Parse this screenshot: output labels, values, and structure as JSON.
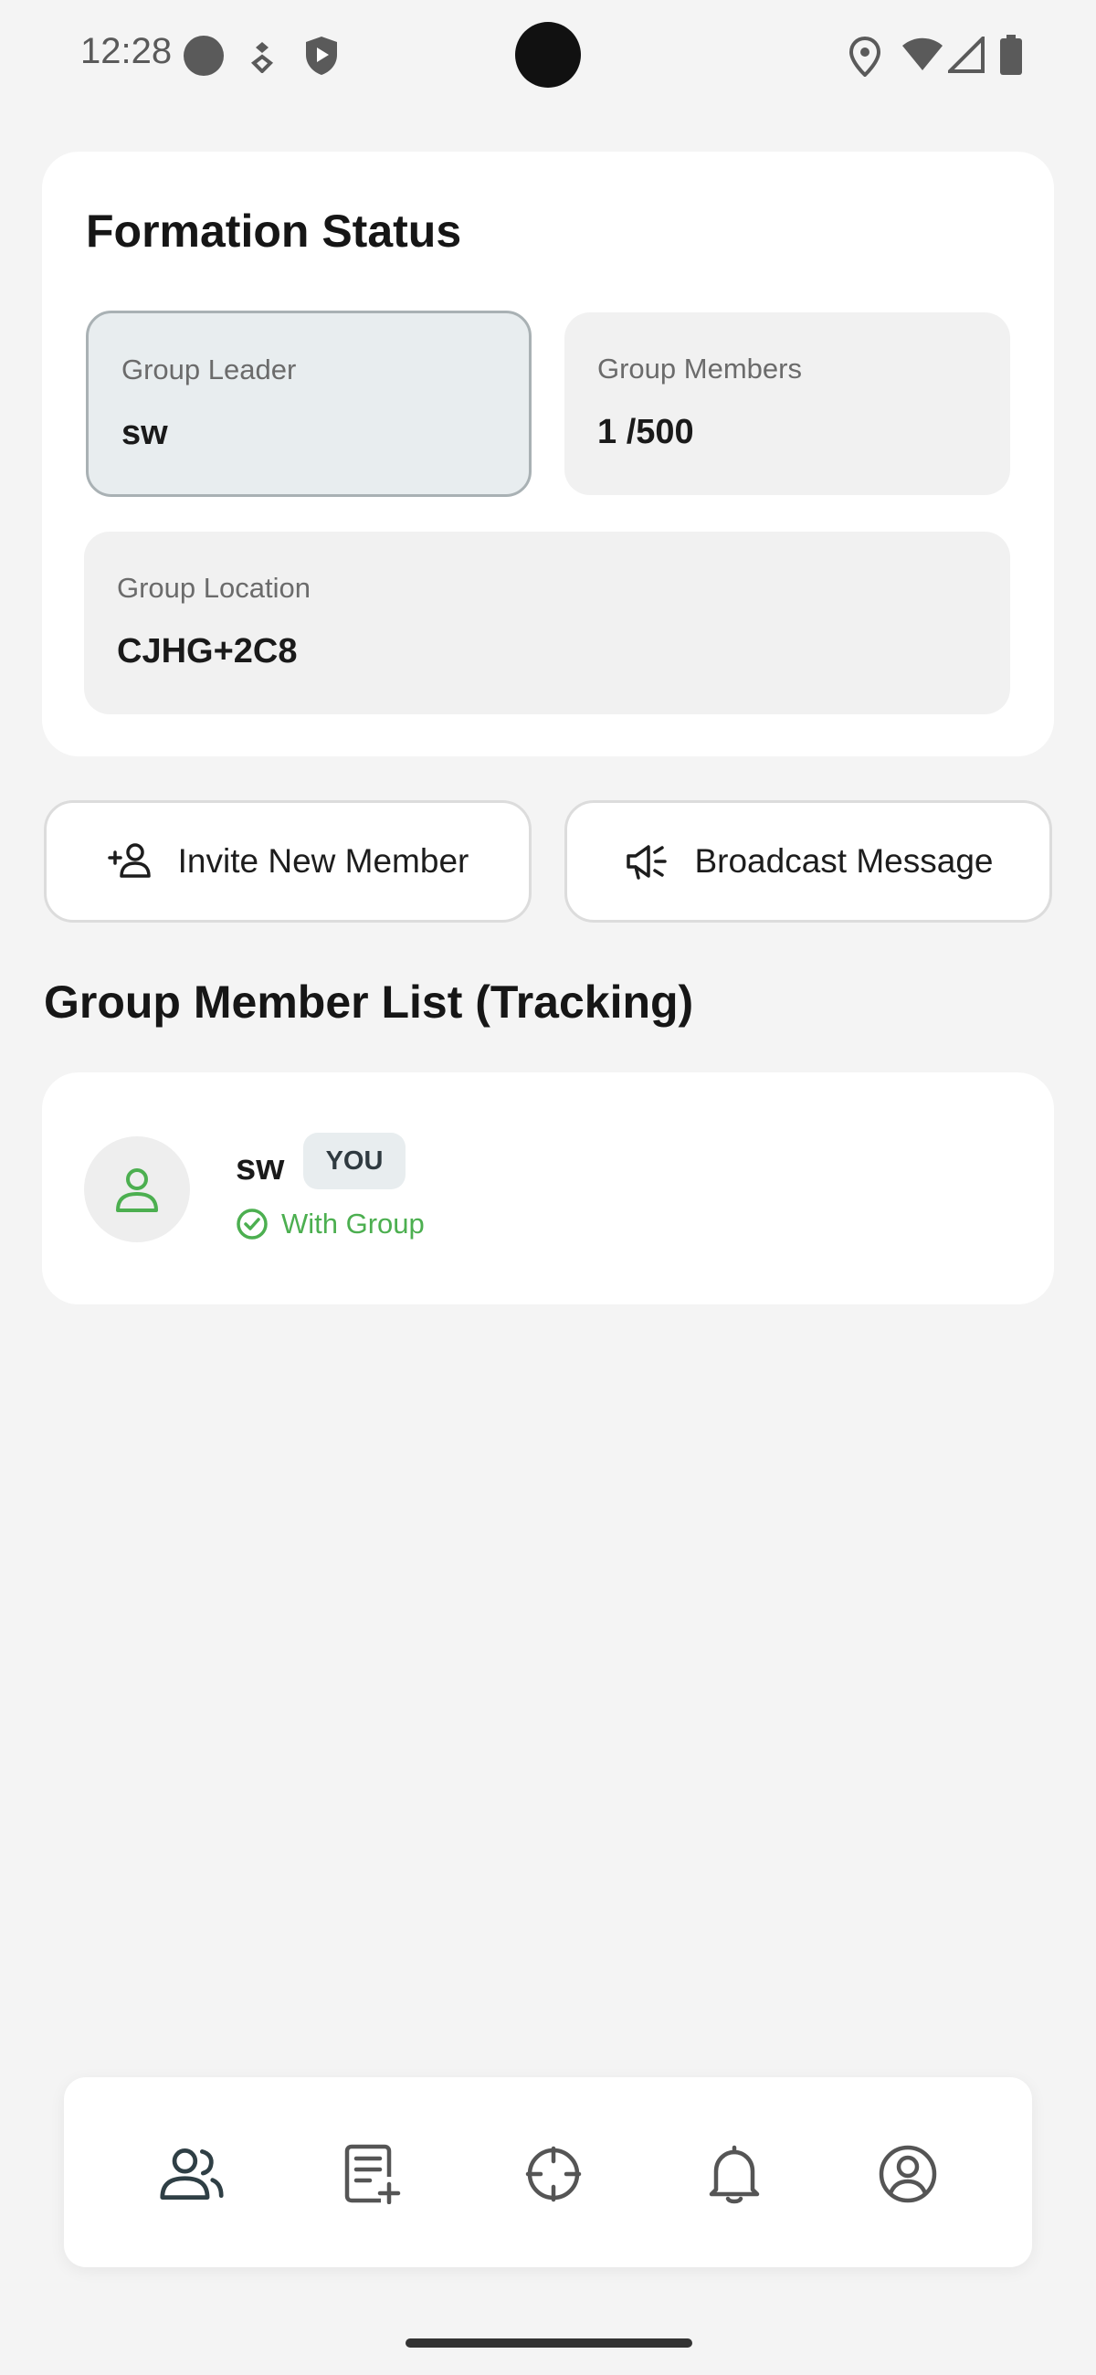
{
  "status_bar": {
    "time": "12:28",
    "icons": [
      "circle-icon",
      "notification-icon",
      "shield-play-icon",
      "location-icon",
      "wifi-icon",
      "signal-icon",
      "battery-icon"
    ]
  },
  "formation": {
    "title": "Formation Status",
    "leader_label": "Group Leader",
    "leader_value": "sw",
    "members_label": "Group Members",
    "members_value": "1 /500",
    "location_label": "Group Location",
    "location_value": "CJHG+2C8"
  },
  "actions": {
    "invite_label": "Invite New Member",
    "invite_icon": "person-add-icon",
    "broadcast_label": "Broadcast Message",
    "broadcast_icon": "megaphone-icon"
  },
  "member_list": {
    "title": "Group Member List (Tracking)",
    "members": [
      {
        "name": "sw",
        "badge": "YOU",
        "status": "With Group",
        "status_color": "#4caf50"
      }
    ]
  },
  "bottom_nav": {
    "items": [
      {
        "icon": "group-icon",
        "active": true
      },
      {
        "icon": "note-add-icon",
        "active": false
      },
      {
        "icon": "crosshair-icon",
        "active": false
      },
      {
        "icon": "bell-icon",
        "active": false
      },
      {
        "icon": "account-circle-icon",
        "active": false
      }
    ]
  },
  "colors": {
    "accent_green": "#4caf50",
    "active_nav": "#2f3f45",
    "background": "#f4f4f4"
  }
}
